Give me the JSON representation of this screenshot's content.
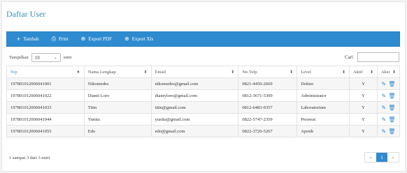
{
  "page": {
    "title": "Daftar User"
  },
  "toolbar": {
    "add_label": "Tambah",
    "print_label": "Print",
    "pdf_label": "Export PDF",
    "xls_label": "Export Xls"
  },
  "length": {
    "prefix": "Tampilkan",
    "value": "10",
    "suffix": "entri"
  },
  "search": {
    "label": "Cari",
    "value": ""
  },
  "table": {
    "headers": [
      "Nip",
      "Nama Lengkap",
      "Email",
      "No.Telp.",
      "Level",
      "Aktif",
      "Aksi"
    ],
    "rows": [
      {
        "nip": "197801012006041001",
        "nama": "Nikomedes",
        "email": "nikomedes@gmail.com",
        "telp": "0821-4450-2669",
        "level": "Dokter",
        "aktif": "Y"
      },
      {
        "nip": "197801012006041022",
        "nama": "Dianti Loro",
        "email": "diantyloro@gmail.com",
        "telp": "0812-3671-5309",
        "level": "Administrator",
        "aktif": "Y"
      },
      {
        "nip": "197801012006041033",
        "nama": "Titin",
        "email": "titin@gmail.com",
        "telp": "0812-6483-9357",
        "level": "Laboratorium",
        "aktif": "Y"
      },
      {
        "nip": "197801012006041044",
        "nama": "Yunita",
        "email": "yunita@gmail.com",
        "telp": "0822-5747-2359",
        "level": "Perawat",
        "aktif": "Y"
      },
      {
        "nip": "197801012006041055",
        "nama": "Edo",
        "email": "edo@gmail.com",
        "telp": "0822-3720-5267",
        "level": "Apotik",
        "aktif": "Y"
      }
    ]
  },
  "footer": {
    "info": "1 sampai 3 dari 3 entri",
    "prev": "«",
    "page": "1",
    "next": "»"
  },
  "colors": {
    "accent": "#2e8bcf",
    "title": "#3c8dbc"
  },
  "icons": {
    "edit": "pencil-icon",
    "delete": "trash-icon"
  }
}
